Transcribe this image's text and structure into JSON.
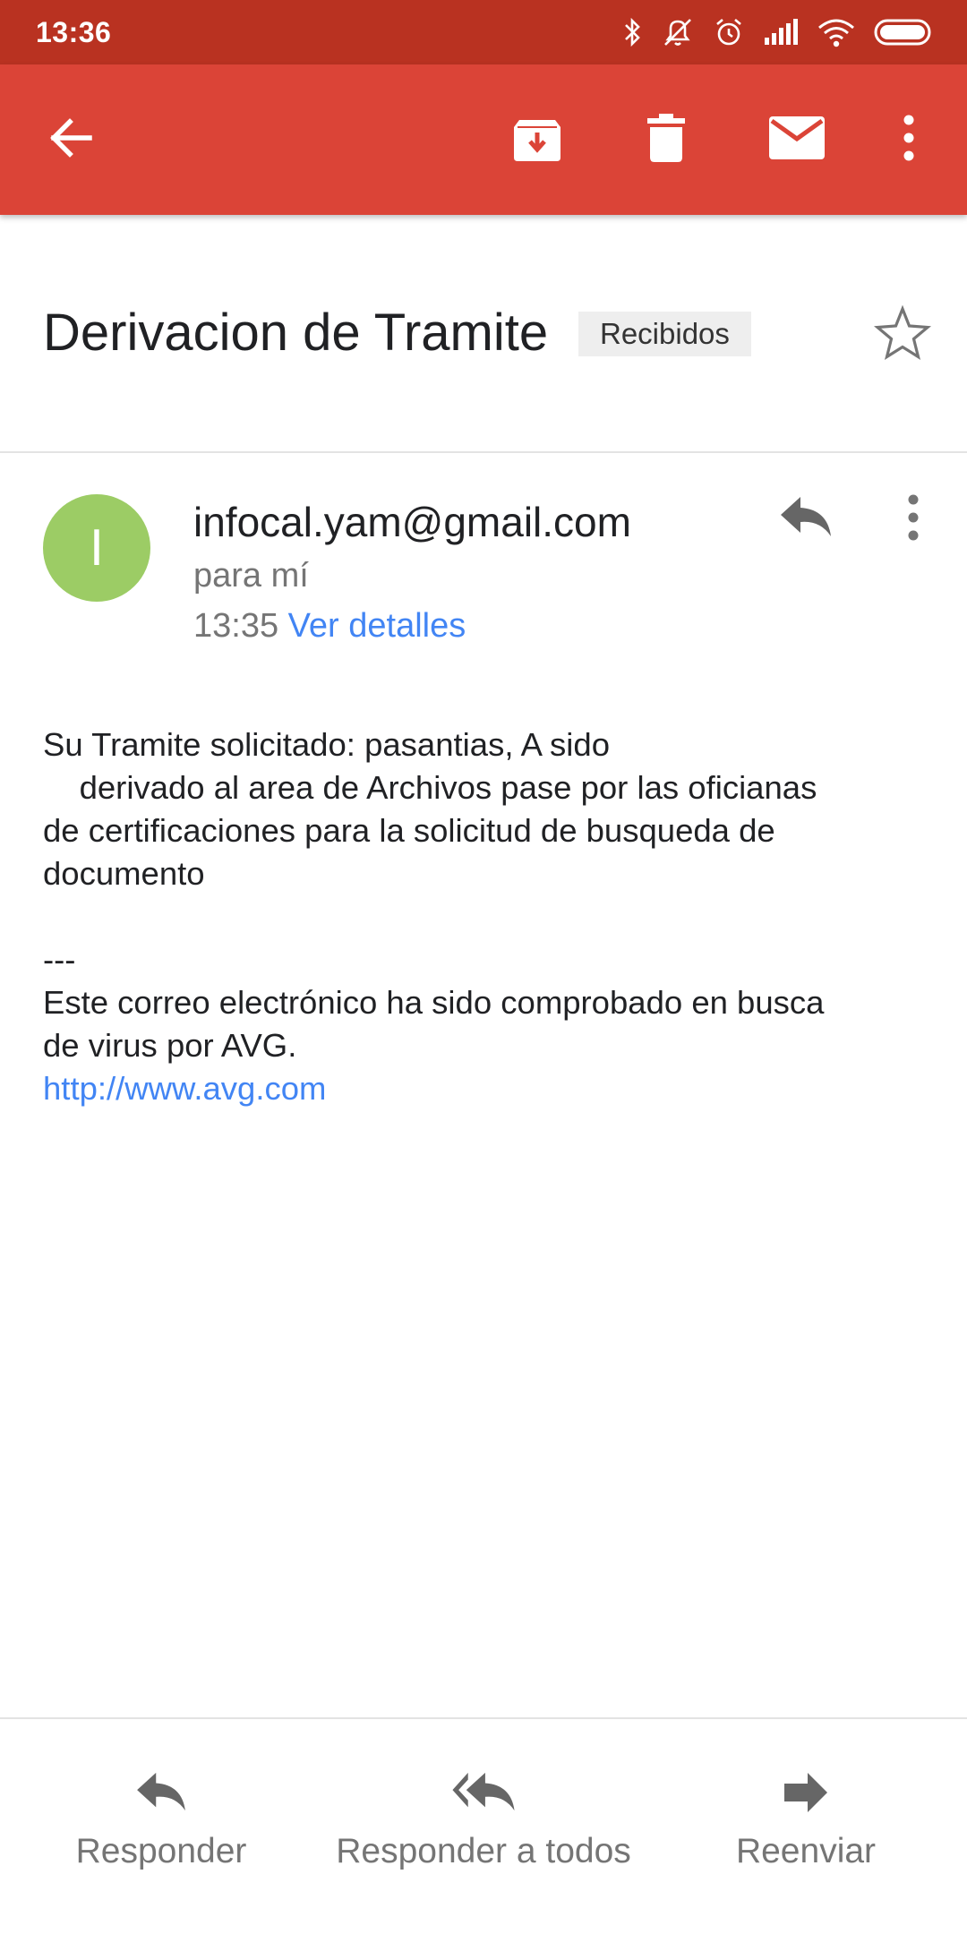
{
  "status_bar": {
    "time": "13:36",
    "icons": [
      "bluetooth-icon",
      "notifications-off-icon",
      "alarm-icon",
      "signal-icon",
      "wifi-icon",
      "battery-icon"
    ]
  },
  "toolbar": {
    "icons": [
      "back-arrow-icon",
      "archive-icon",
      "delete-icon",
      "mark-unread-icon",
      "more-vert-icon"
    ]
  },
  "email": {
    "subject": "Derivacion de Tramite",
    "label": "Recibidos",
    "avatar_letter": "I",
    "sender": "infocal.yam@gmail.com",
    "recipient": "para mí",
    "time": "13:35",
    "details_link": "Ver detalles",
    "body_lines": [
      "Su Tramite solicitado: pasantias, A sido",
      "    derivado al area de Archivos pase por las oficianas",
      "de certificaciones para la solicitud de busqueda de",
      "documento",
      "",
      "---",
      "Este correo electrónico ha sido comprobado en busca",
      "de virus por AVG."
    ],
    "link": "http://www.avg.com"
  },
  "actions": {
    "reply": "Responder",
    "reply_all": "Responder a todos",
    "forward": "Reenviar"
  },
  "colors": {
    "status_bar": "#b93221",
    "app_bar": "#db4437",
    "avatar": "#9ccc65",
    "link": "#4285f4"
  }
}
